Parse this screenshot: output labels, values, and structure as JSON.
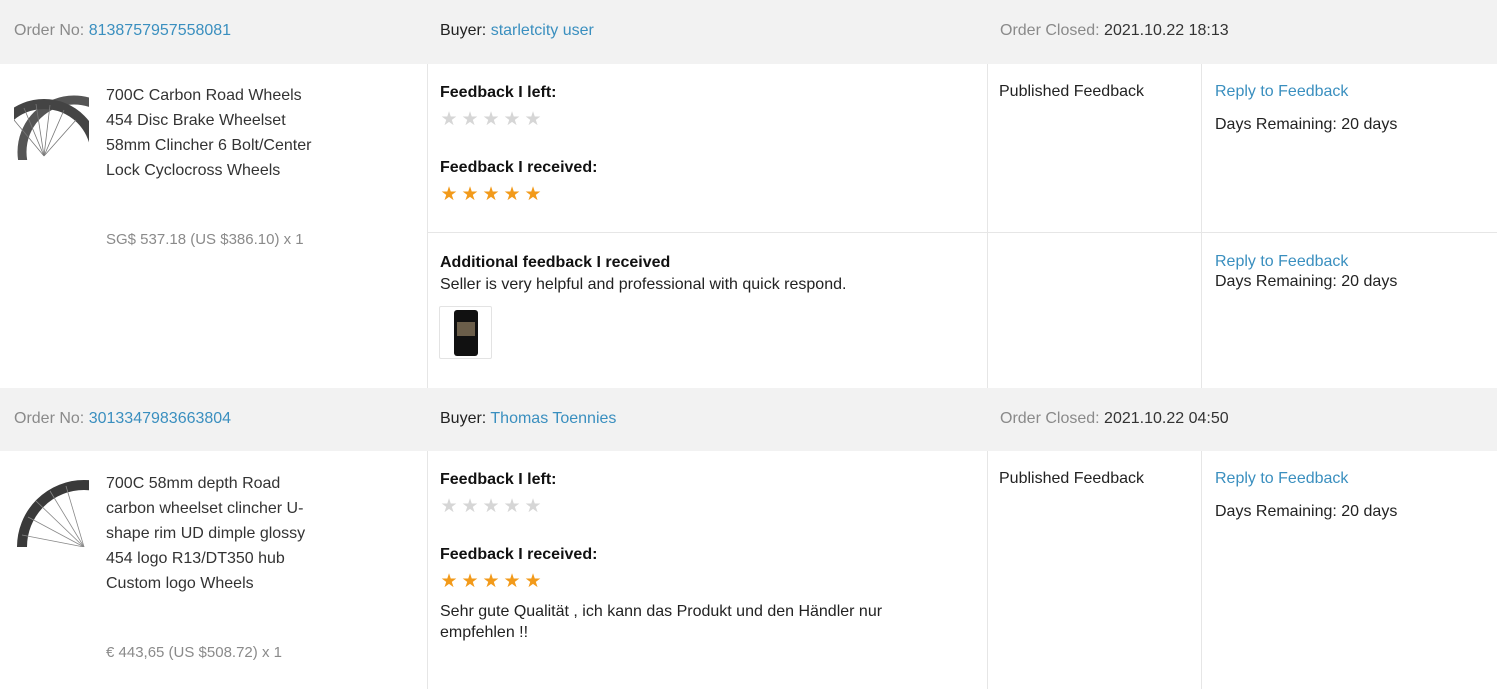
{
  "orders": [
    {
      "order_no_label": "Order No:",
      "order_no": "8138757957558081",
      "buyer_label": "Buyer:",
      "buyer": "starletcity user",
      "closed_label": "Order Closed:",
      "closed": "2021.10.22 18:13",
      "product_title": "700C Carbon Road Wheels 454 Disc Brake Wheelset 58mm Clincher 6 Bolt/Center Lock Cyclocross Wheels",
      "product_price": "SG$ 537.18 (US $386.10) x 1",
      "feedback_left_label": "Feedback I left:",
      "feedback_left_rating": 0,
      "feedback_received_label": "Feedback I received:",
      "feedback_received_rating": 5,
      "status": "Published Feedback",
      "reply_label": "Reply to Feedback",
      "days_remaining": "Days Remaining: 20 days",
      "additional": {
        "label": "Additional feedback I received",
        "text": "Seller is very helpful and professional with quick respond.",
        "reply_label": "Reply to Feedback",
        "days_remaining": "Days Remaining: 20 days"
      }
    },
    {
      "order_no_label": "Order No:",
      "order_no": "3013347983663804",
      "buyer_label": "Buyer:",
      "buyer": "Thomas Toennies",
      "closed_label": "Order Closed:",
      "closed": "2021.10.22 04:50",
      "product_title": "700C 58mm depth Road carbon wheelset clincher U-shape rim UD dimple glossy 454 logo R13/DT350 hub Custom logo Wheels",
      "product_price": "€ 443,65 (US $508.72) x 1",
      "feedback_left_label": "Feedback I left:",
      "feedback_left_rating": 0,
      "feedback_received_label": "Feedback I received:",
      "feedback_received_rating": 5,
      "feedback_received_text": "Sehr gute Qualität , ich kann das Produkt und den Händler nur empfehlen !!",
      "status": "Published Feedback",
      "reply_label": "Reply to Feedback",
      "days_remaining": "Days Remaining: 20 days"
    }
  ],
  "colors": {
    "link": "#3a8fbf",
    "star_full": "#f29a1a",
    "star_empty": "#d6d6d6",
    "header_bg": "#f2f2f2"
  },
  "icons": {
    "star": "star-icon"
  }
}
